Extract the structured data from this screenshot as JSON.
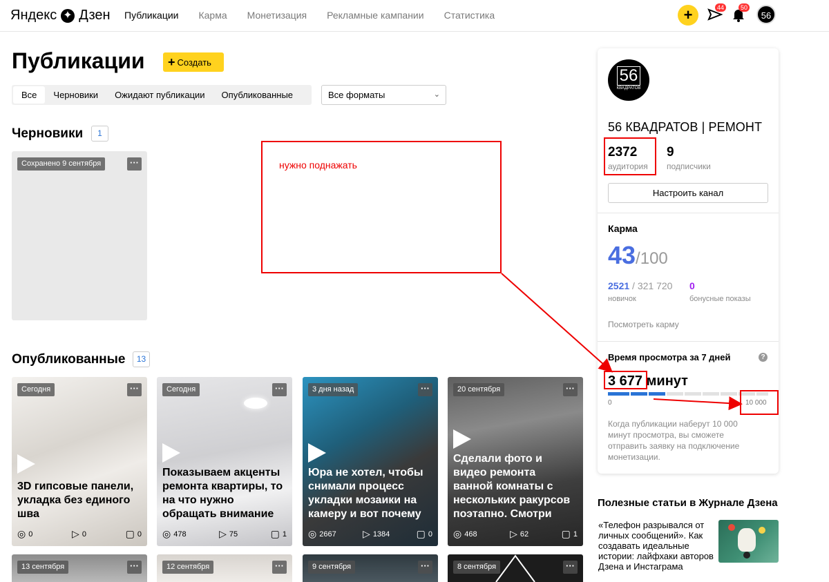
{
  "header": {
    "logo_text_1": "Яндекс",
    "logo_text_2": "Дзен",
    "nav": [
      {
        "label": "Публикации",
        "active": true
      },
      {
        "label": "Карма",
        "active": false
      },
      {
        "label": "Монетизация",
        "active": false
      },
      {
        "label": "Рекламные кампании",
        "active": false
      },
      {
        "label": "Статистика",
        "active": false
      }
    ],
    "plus_icon": "plus-icon",
    "messages_badge": "44",
    "notifications_badge": "50",
    "avatar_text": "56"
  },
  "main": {
    "title": "Публикации",
    "create_label": "Создать",
    "tabs": [
      "Все",
      "Черновики",
      "Ожидают публикации",
      "Опубликованные"
    ],
    "format_select": "Все форматы",
    "drafts": {
      "title": "Черновики",
      "count": "1",
      "card_tag": "Сохранено 9 сентября"
    },
    "published": {
      "title": "Опубликованные",
      "count": "13",
      "cards": [
        {
          "tag": "Сегодня",
          "title": "3D гипсовые панели, укладка без единого шва",
          "views": "0",
          "plays": "0",
          "comments": "0"
        },
        {
          "tag": "Сегодня",
          "title": "Показываем акценты ремонта квартиры, то на что нужно обращать внимание",
          "views": "478",
          "plays": "75",
          "comments": "1"
        },
        {
          "tag": "3 дня назад",
          "title": "Юра не хотел, чтобы снимали процесс укладки мозаики на камеру и вот почему",
          "views": "2667",
          "plays": "1384",
          "comments": "0"
        },
        {
          "tag": "20 сентября",
          "title": "Сделали фото и видео ремонта ванной комнаты с нескольких ракурсов поэтапно. Смотри",
          "views": "468",
          "plays": "62",
          "comments": "1"
        }
      ],
      "bottom_tags": [
        "13 сентября",
        "12 сентября",
        "9 сентября",
        "8 сентября"
      ]
    }
  },
  "annotation": {
    "text": "нужно поднажать",
    "color": "#ee0000"
  },
  "panel": {
    "channel_name": "56 КВАДРАТОВ | РЕМОНТ",
    "avatar_big": "56",
    "avatar_small": "КВАДРАТОВ",
    "audience_num": "2372",
    "audience_label": "аудитория",
    "subs_num": "9",
    "subs_label": "подписчики",
    "setup_label": "Настроить канал",
    "karma": {
      "title": "Карма",
      "value": "43",
      "max": "/100",
      "rank_pos": "2521",
      "rank_total": " / 321 720",
      "rank_label": "новичок",
      "bonus": "0",
      "bonus_label": "бонусные показы",
      "link": "Посмотреть карму"
    },
    "watch": {
      "title": "Время просмотра за 7 дней",
      "value": "3 677",
      "unit": "минут",
      "progress_fraction": 0.3677,
      "min_label": "0",
      "max_label": "10 000",
      "note": "Когда публикации наберут 10 000 минут просмотра, вы сможете отправить заявку на подключение монетизации."
    }
  },
  "useful": {
    "title": "Полезные статьи в Журнале Дзена",
    "article": "«Телефон разрывался от личных сообщений». Как создавать идеальные истории: лайфхаки авторов Дзена и Инстаграма"
  },
  "colors": {
    "accent_yellow": "#ffd21e",
    "link_blue": "#2a74d6",
    "karma_blue": "#4a6ee0",
    "bonus_purple": "#a020f0"
  }
}
